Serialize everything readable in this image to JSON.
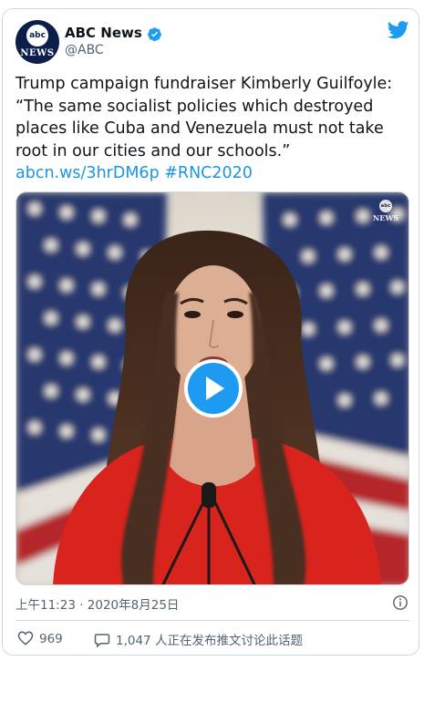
{
  "account": {
    "name": "ABC News",
    "handle": "@ABC",
    "avatar_top": "abc",
    "avatar_bottom": "NEWS"
  },
  "tweet": {
    "text": "Trump campaign fundraiser Kimberly Guilfoyle: “The same socialist policies which destroyed places like Cuba and Venezuela must not take root in our cities and our schools.” ",
    "link": "abcn.ws/3hrDM6p",
    "hashtag": "#RNC2020"
  },
  "media": {
    "watermark_top": "abc",
    "watermark_bottom": "NEWS",
    "play_icon": "play-icon"
  },
  "meta": {
    "timestamp": "上午11:23 · 2020年8月25日"
  },
  "actions": {
    "likes": "969",
    "replies": "1,047 人正在发布推文讨论此话题"
  },
  "colors": {
    "brand": "#1d9bf0",
    "link": "#1b95e0",
    "muted": "#536471",
    "dress": "#d9231d"
  },
  "icons": {
    "verified": "verified-badge-icon",
    "bird": "twitter-bird-icon",
    "info": "info-icon",
    "like": "heart-icon",
    "reply": "speech-bubble-icon"
  }
}
